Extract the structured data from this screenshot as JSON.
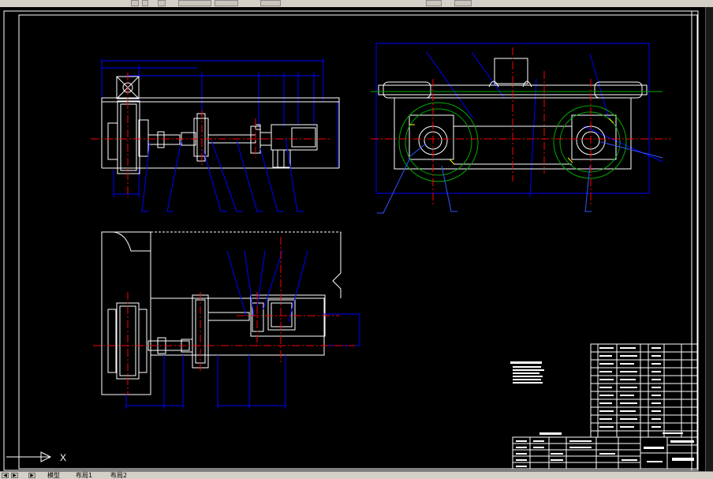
{
  "toolbar": {
    "buttons": [
      "layer-tool",
      "properties-tool",
      "zoom-tool",
      "pan-tool",
      "match-tool",
      "undo-tool",
      "redo-tool",
      "help-tool"
    ]
  },
  "drawing": {
    "colors": {
      "background": "#000000",
      "frame": "#ffffff",
      "dimension": "#0000ff",
      "centerline": "#ff0000",
      "rail": "#00aa00",
      "leader": "#3355ff"
    },
    "ucs": {
      "x_label": "X"
    },
    "title_block": {
      "rows": 12,
      "small_block_rows": 7
    }
  },
  "tabs": {
    "model": "模型",
    "layout1": "布局1",
    "layout2": "布局2"
  }
}
